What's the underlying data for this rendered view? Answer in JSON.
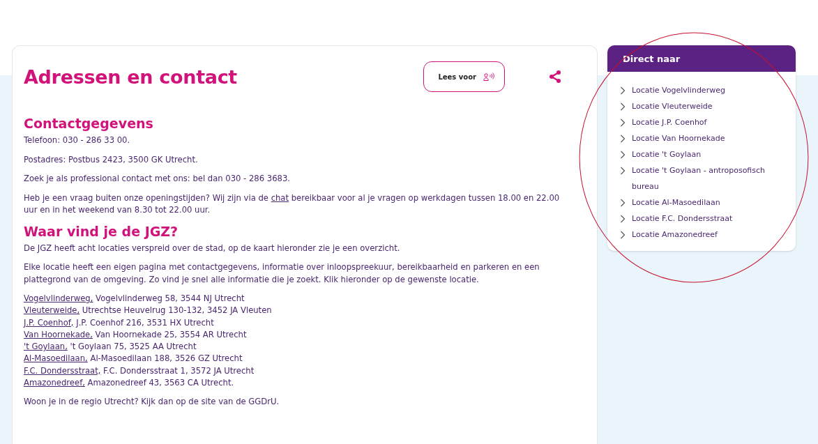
{
  "title": "Adressen en contact",
  "read_aloud_button": {
    "label": "Lees voor"
  },
  "sections": [
    {
      "heading": "Contactgegevens",
      "paragraphs": [
        {
          "parts": [
            {
              "text": "Telefoon: 030 - 286 33 00."
            }
          ]
        },
        {
          "parts": [
            {
              "text": "Postadres: Postbus 2423, 3500 GK Utrecht."
            }
          ]
        },
        {
          "parts": [
            {
              "text": "Zoek je als professional contact met ons: bel dan 030 - 286 3683."
            }
          ]
        },
        {
          "parts": [
            {
              "text": "Heb je een vraag buiten onze openingstijden? Wij zijn via de "
            },
            {
              "text": "chat",
              "link": true
            },
            {
              "text": " bereikbaar voor al je vragen op werkdagen tussen 18.00 en 22.00 uur en in het weekend van 8.30 tot 22.00 uur."
            }
          ]
        }
      ]
    },
    {
      "heading": "Waar vind je de JGZ?",
      "paragraphs": [
        {
          "parts": [
            {
              "text": "De JGZ heeft acht locaties verspreid over de stad, op de kaart hieronder zie je een overzicht."
            }
          ]
        },
        {
          "parts": [
            {
              "text": "Elke locatie heeft een eigen pagina met contactgegevens, informatie over inloopspreekuur, bereikbaarheid en parkeren en een plattegrond van de omgeving. Zo vind je snel alle informatie die je zoekt. Klik hieronder op de gewenste locatie."
            }
          ]
        }
      ],
      "addresses": [
        {
          "link": "Vogelvlinderweg,",
          "address": "Vogelvlinderweg 58, 3544 NJ Utrecht"
        },
        {
          "link": "Vleuterweide,",
          "address": "Utrechtse Heuvelrug 130-132, 3452 JA Vleuten"
        },
        {
          "link": "J.P. Coenhof,",
          "address": "J.P. Coenhof 216, 3531 HX Utrecht"
        },
        {
          "link": "Van Hoornekade,",
          "address": "Van Hoornekade 25, 3554 AR Utrecht"
        },
        {
          "link": "'t Goylaan,",
          "address": "'t Goylaan 75, 3525 AA Utrecht"
        },
        {
          "link": "Al-Masoedilaan,",
          "address": "Al-Masoedilaan 188, 3526 GZ Utrecht"
        },
        {
          "link": "F.C. Dondersstraat,",
          "address": "F.C. Dondersstraat 1, 3572 JA Utrecht"
        },
        {
          "link": "Amazonedreef,",
          "address": "Amazonedreef 43, 3563 CA Utrecht."
        }
      ],
      "footer_paragraphs": [
        {
          "parts": [
            {
              "text": "Woon je in de regio Utrecht? Kijk dan op de site van de GGDrU."
            }
          ]
        }
      ]
    }
  ],
  "sidebar": {
    "title": "Direct naar",
    "items": [
      {
        "label": "Locatie Vogelvlinderweg"
      },
      {
        "label": "Locatie Vleuterweide"
      },
      {
        "label": "Locatie J.P. Coenhof"
      },
      {
        "label": "Locatie Van Hoornekade"
      },
      {
        "label": "Locatie 't Goylaan"
      },
      {
        "label": "Locatie 't Goylaan - antroposofisch bureau"
      },
      {
        "label": "Locatie Al-Masoedilaan"
      },
      {
        "label": "Locatie F.C. Dondersstraat"
      },
      {
        "label": "Locatie Amazonedreef"
      }
    ]
  }
}
